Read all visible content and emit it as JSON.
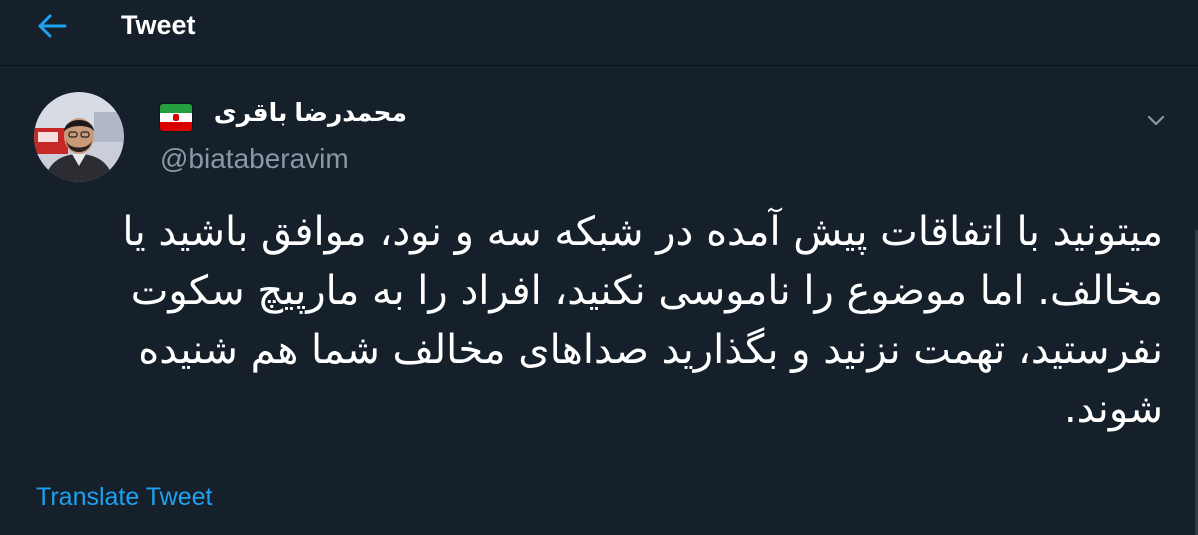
{
  "header": {
    "title": "Tweet",
    "back_icon": "arrow-left-icon"
  },
  "author": {
    "display_name": "محمدرضا باقری",
    "badge_icon": "iran-flag-icon",
    "handle": "@biataberavim"
  },
  "tweet": {
    "lines": [
      "میتونید با اتفاقات پیش آمده در شبکه سه و نود، موافق باشید یا",
      "مخالف. اما موضوع را ناموسی نکنید، افراد را به مارپیچ سکوت",
      "نفرستید، تهمت نزنید و بگذارید صداهای مخالف شما هم شنیده",
      "شوند."
    ],
    "translate_label": "Translate Tweet",
    "menu_icon": "chevron-down-icon"
  },
  "colors": {
    "background": "#15202b",
    "accent": "#1da1f2",
    "secondary_text": "#8899a6"
  }
}
